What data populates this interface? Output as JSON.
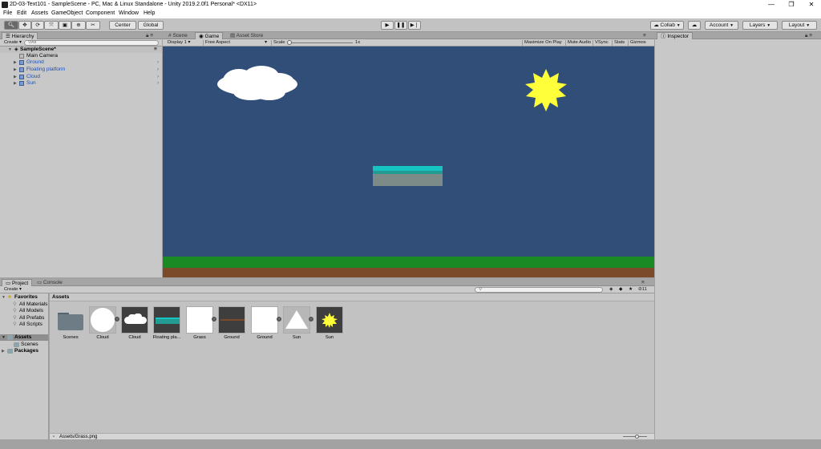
{
  "window": {
    "title": "2D-03-Text101 - SampleScene - PC, Mac & Linux Standalone - Unity 2019.2.0f1 Personal* <DX11>",
    "minimize": "—",
    "maximize": "❐",
    "close": "✕"
  },
  "menu": [
    "File",
    "Edit",
    "Assets",
    "GameObject",
    "Component",
    "Window",
    "Help"
  ],
  "toolbar": {
    "tools": [
      "hand-icon",
      "move-icon",
      "rotate-icon",
      "scale-icon",
      "rect-icon",
      "transform-icon",
      "custom-icon"
    ],
    "pivot": "Center",
    "space": "Global",
    "collab": "Collab",
    "account": "Account",
    "layers": "Layers",
    "layout": "Layout"
  },
  "hierarchy": {
    "tab": "Hierarchy",
    "create": "Create",
    "search_placeholder": "All",
    "scene": "SampleScene*",
    "items": [
      "Main Camera",
      "Ground",
      "Floating platform",
      "Cloud",
      "Sun"
    ]
  },
  "center_tabs": [
    "Scene",
    "Game",
    "Asset Store"
  ],
  "game_bar": {
    "display": "Display 1",
    "aspect": "Free Aspect",
    "scale_label": "Scale",
    "scale_value": "1x",
    "maximize": "Maximize On Play",
    "mute": "Mute Audio",
    "vsync": "VSync",
    "stats": "Stats",
    "gizmos": "Gizmos"
  },
  "inspector": {
    "tab": "Inspector"
  },
  "project": {
    "tabs": [
      "Project",
      "Console"
    ],
    "create": "Create",
    "count": "11",
    "favorites_label": "Favorites",
    "favorites": [
      "All Materials",
      "All Models",
      "All Prefabs",
      "All Scripts"
    ],
    "assets_label": "Assets",
    "assets_children": [
      "Scenes"
    ],
    "packages_label": "Packages",
    "breadcrumb": "Assets",
    "assets": [
      {
        "name": "Scenes",
        "kind": "folder"
      },
      {
        "name": "Cloud",
        "kind": "circle"
      },
      {
        "name": "Cloud",
        "kind": "cloud"
      },
      {
        "name": "Floating pla...",
        "kind": "platform"
      },
      {
        "name": "Grass",
        "kind": "white"
      },
      {
        "name": "Ground",
        "kind": "ground"
      },
      {
        "name": "Ground",
        "kind": "white"
      },
      {
        "name": "Sun",
        "kind": "triangle"
      },
      {
        "name": "Sun",
        "kind": "sun"
      }
    ],
    "status_path": "Assets/Grass.png"
  },
  "colors": {
    "game_bg": "#304e78",
    "grass": "#1a8a24",
    "dirt": "#7b4a2a",
    "sun": "#ffff3a",
    "platform_top": "#16c3c3",
    "platform_mid": "#239a92",
    "platform_body": "#7c8a88"
  }
}
